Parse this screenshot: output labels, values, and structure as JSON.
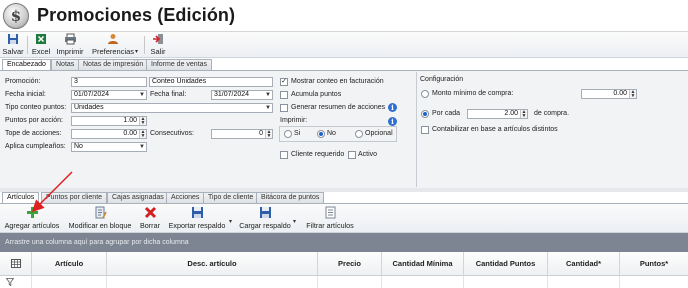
{
  "window": {
    "title": "Promociones (Edición)",
    "logo_symbol": "$"
  },
  "toolbar": {
    "guardar": "Salvar",
    "excel": "Excel",
    "imprimir": "Imprimir",
    "preferencias": "Preferencias",
    "salir": "Salir"
  },
  "top_tabs": [
    "Encabezado",
    "Notas",
    "Notas de impresión",
    "Informe de ventas"
  ],
  "form": {
    "promocion_label": "Promoción:",
    "promocion_value": "3",
    "descripcion_value": "Conteo Unidades",
    "fecha_inicial_label": "Fecha inicial:",
    "fecha_inicial_value": "01/07/2024",
    "fecha_final_label": "Fecha final:",
    "fecha_final_value": "31/07/2024",
    "tipo_conteo_label": "Tipo conteo puntos:",
    "tipo_conteo_value": "Unidades",
    "puntos_accion_label": "Puntos por acción:",
    "puntos_accion_value": "1.00",
    "tope_acciones_label": "Tope de acciones:",
    "tope_acciones_value": "0.00",
    "consecutivos_label": "Consecutivos:",
    "consecutivos_value": "0",
    "aplica_cumple_label": "Aplica cumpleaños:",
    "aplica_cumple_value": "No",
    "mostrar_conteo_label": "Mostrar conteo en facturación",
    "mostrar_conteo_checked": true,
    "acumula_puntos_label": "Acumula puntos",
    "acumula_puntos_checked": false,
    "generar_resumen_label": "Generar resumen de acciones",
    "generar_resumen_checked": false,
    "imprimir_label": "Imprimir:",
    "imprimir_opts": [
      "Si",
      "No",
      "Opcional"
    ],
    "imprimir_selected": "No",
    "cliente_requerido_label": "Cliente requerido",
    "activo_label": "Activo"
  },
  "config": {
    "title": "Configuración",
    "monto_label": "Monto mínimo de compra:",
    "monto_value": "0.00",
    "por_cada_label": "Por cada",
    "por_cada_value": "2.00",
    "de_compra_label": "de compra.",
    "contabilizar_label": "Contabilizar en base a artículos distintos"
  },
  "bottom_tabs": [
    "Artículos",
    "Puntos por cliente",
    "Cajas asignadas",
    "Acciones",
    "Tipo de cliente",
    "Bitácora de puntos"
  ],
  "toolbar2": {
    "agregar": "Agregar artículos",
    "modificar": "Modificar en bloque",
    "borrar": "Borrar",
    "exportar": "Exportar respaldo",
    "cargar": "Cargar respaldo",
    "filtrar": "Filtrar artículos"
  },
  "grid": {
    "group_hint": "Arrastre una columna aquí para agrupar por dicha columna",
    "columns": [
      "Artículo",
      "Desc. artículo",
      "Precio",
      "Cantidad Mínima",
      "Cantidad Puntos",
      "Cantidad*",
      "Puntos*"
    ]
  },
  "colors": {
    "accent": "#2e6fd1",
    "annotation_arrow": "#e02020",
    "group_hint_bg": "#7c8591"
  }
}
